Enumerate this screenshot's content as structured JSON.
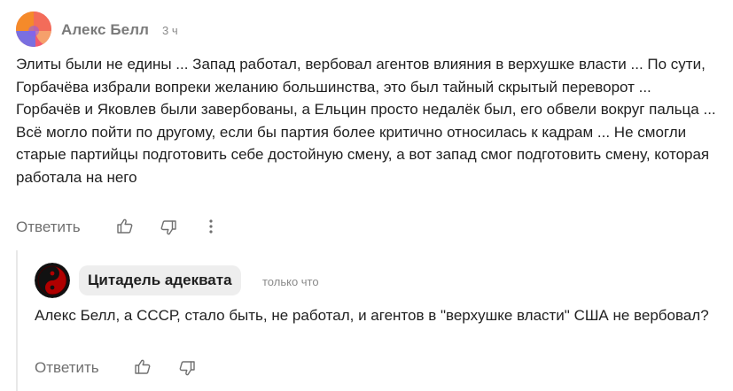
{
  "main_comment": {
    "author": "Алекс Белл",
    "time": "3 ч",
    "text": "Элиты были не едины ... Запад работал, вербовал агентов влияния в верхушке власти ... По сути, Горбачёва избрали вопреки желанию большинства, это был тайный скрытый переворот ... Горбачёв и Яковлев были завербованы, а Ельцин просто недалёк был, его обвели вокруг пальца ... Всё могло пойти по другому, если бы партия более критично относилась к кадрам ... Не смогли старые партийцы подготовить себе достойную смену, а вот запад смог подготовить смену, которая работала на него",
    "reply_label": "Ответить",
    "icons": [
      "thumbs-up-icon",
      "thumbs-down-icon",
      "more-vertical-icon"
    ],
    "avatar_colors": [
      "#f58a2a",
      "#f25b6e",
      "#8a5cf0",
      "#7a6fe0"
    ]
  },
  "reply_comment": {
    "author": "Цитадель адеквата",
    "time": "только что",
    "text": "Алекс Белл, а СССР, стало быть, не работал, и агентов в \"верхушке власти\" США не вербовал?",
    "reply_label": "Ответить",
    "icons": [
      "thumbs-up-icon",
      "thumbs-down-icon"
    ],
    "avatar_colors": [
      "#b00000",
      "#111111"
    ]
  }
}
